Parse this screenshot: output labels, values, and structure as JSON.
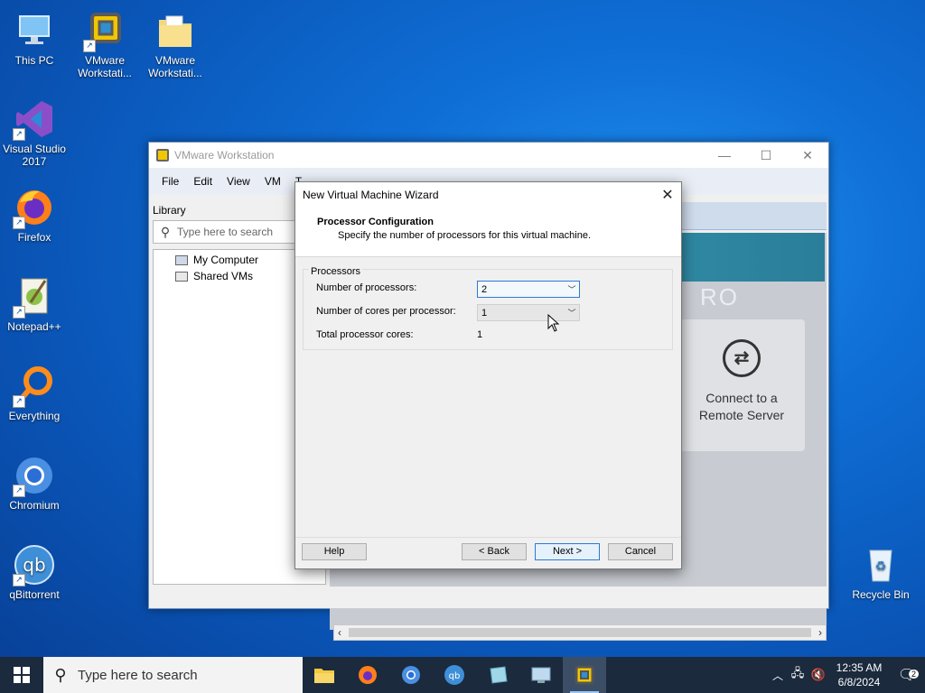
{
  "desktop": {
    "icons": [
      {
        "label": "This PC"
      },
      {
        "label": "VMware Workstati..."
      },
      {
        "label": "VMware Workstati..."
      },
      {
        "label": "Visual Studio 2017"
      },
      {
        "label": "Firefox"
      },
      {
        "label": "Notepad++"
      },
      {
        "label": "Everything"
      },
      {
        "label": "Chromium"
      },
      {
        "label": "qBittorrent"
      },
      {
        "label": "Recycle Bin"
      }
    ]
  },
  "vmware": {
    "title": "VMware Workstation",
    "menu": [
      "File",
      "Edit",
      "View",
      "VM",
      "T"
    ],
    "library_label": "Library",
    "search_placeholder": "Type here to search",
    "tree": [
      "My Computer",
      "Shared VMs"
    ],
    "banner_text": "RO",
    "connect_card": {
      "line1": "Connect to a",
      "line2": "Remote Server"
    }
  },
  "wizard": {
    "title": "New Virtual Machine Wizard",
    "heading": "Processor Configuration",
    "subheading": "Specify the number of processors for this virtual machine.",
    "group_label": "Processors",
    "num_processors_label": "Number of processors:",
    "num_processors_value": "2",
    "cores_label": "Number of cores per processor:",
    "cores_value": "1",
    "total_label": "Total processor cores:",
    "total_value": "1",
    "buttons": {
      "help": "Help",
      "back": "< Back",
      "next": "Next >",
      "cancel": "Cancel"
    }
  },
  "taskbar": {
    "search_placeholder": "Type here to search",
    "time": "12:35 AM",
    "date": "6/8/2024",
    "notification_count": "2"
  }
}
